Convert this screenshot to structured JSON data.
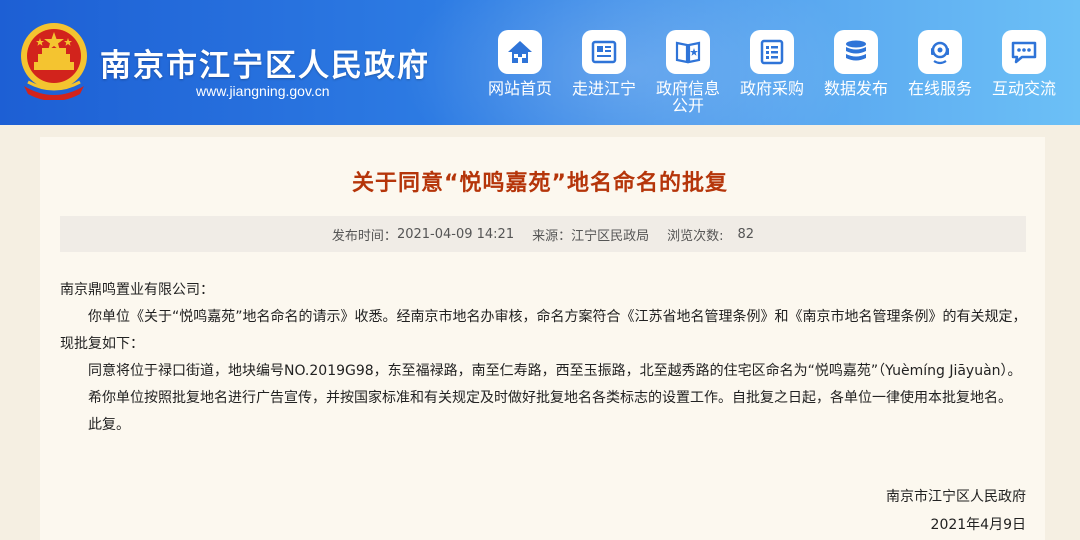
{
  "header": {
    "site_title": "南京市江宁区人民政府",
    "site_url": "www.jiangning.gov.cn",
    "colors": {
      "header_start": "#1d5fd4",
      "header_end": "#6cc0f6",
      "emblem_red": "#d2231c",
      "emblem_gold": "#f4c430",
      "title_accent": "#b5350a"
    }
  },
  "nav": {
    "items": [
      {
        "label": "网站首页",
        "icon": "home-icon"
      },
      {
        "label": "走进江宁",
        "icon": "newspaper-icon"
      },
      {
        "label": "政府信息公开",
        "icon": "book-icon"
      },
      {
        "label": "政府采购",
        "icon": "list-icon"
      },
      {
        "label": "数据发布",
        "icon": "database-icon"
      },
      {
        "label": "在线服务",
        "icon": "headset-icon"
      },
      {
        "label": "互动交流",
        "icon": "chat-icon"
      }
    ]
  },
  "article": {
    "title": "关于同意“悦鸣嘉苑”地名命名的批复",
    "meta": {
      "published_label": "发布时间：",
      "published": "2021-04-09 14:21",
      "source_label": "来源：",
      "source": "江宁区民政局",
      "views_label": "浏览次数:",
      "views": "82"
    },
    "salutation": "南京鼎鸣置业有限公司：",
    "paragraphs": [
      "你单位《关于“悦鸣嘉苑”地名命名的请示》收悉。经南京市地名办审核，命名方案符合《江苏省地名管理条例》和《南京市地名管理条例》的有关规定，现批复如下：",
      "同意将位于禄口街道，地块编号NO.2019G98，东至福禄路，南至仁寿路，西至玉振路，北至越秀路的住宅区命名为“悦鸣嘉苑”（Yuèmíng Jiāyuàn）。",
      "希你单位按照批复地名进行广告宣传，并按国家标准和有关规定及时做好批复地名各类标志的设置工作。自批复之日起，各单位一律使用本批复地名。",
      "此复。"
    ],
    "signature": "南京市江宁区人民政府",
    "date": "2021年4月9日"
  }
}
